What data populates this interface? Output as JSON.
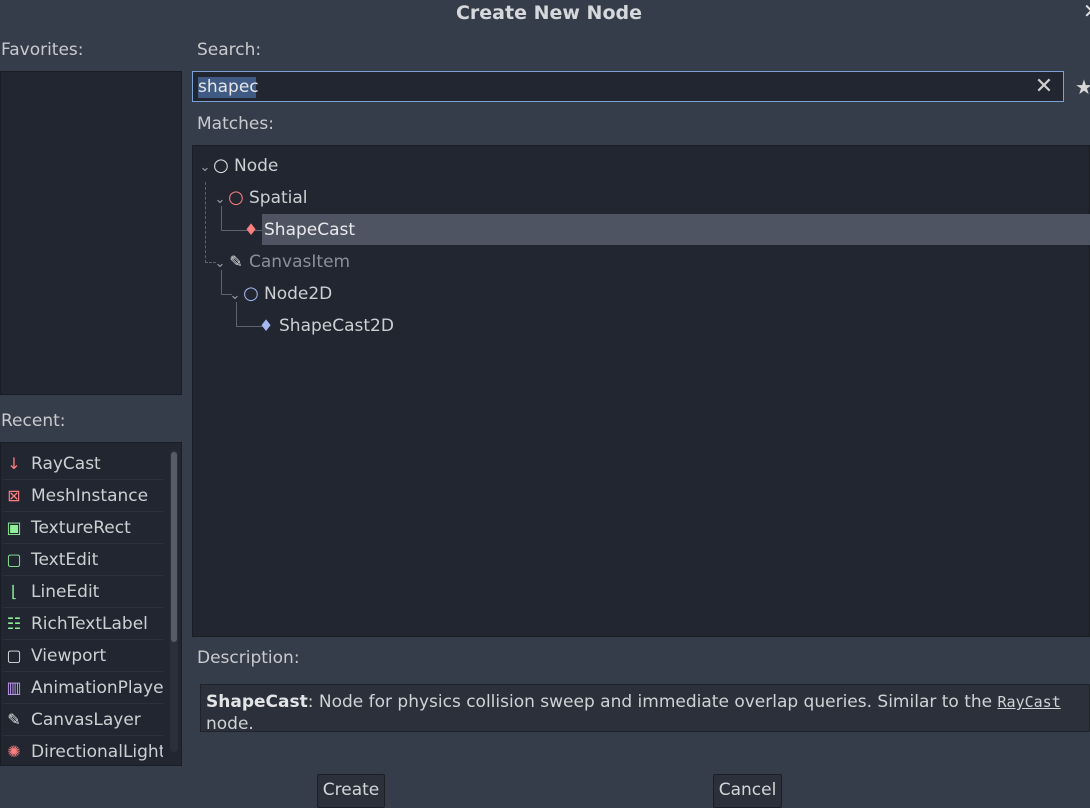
{
  "dialog": {
    "title": "Create New Node",
    "close_glyph": "✕"
  },
  "favorites": {
    "label": "Favorites:"
  },
  "search": {
    "label": "Search:",
    "value": "shapec",
    "clear_glyph": "✕",
    "favorite_glyph": "★"
  },
  "matches": {
    "label": "Matches:",
    "items": [
      {
        "label": "Node",
        "icon": "node-circle-icon",
        "color": "#e0e0e0"
      },
      {
        "label": "Spatial",
        "icon": "spatial-circle-icon",
        "color": "#fc7f7f"
      },
      {
        "label": "ShapeCast",
        "icon": "shapecast-icon",
        "color": "#fc7f7f"
      },
      {
        "label": "CanvasItem",
        "icon": "brush-icon",
        "color": "#e0e0e0"
      },
      {
        "label": "Node2D",
        "icon": "node2d-circle-icon",
        "color": "#a5b7f3"
      },
      {
        "label": "ShapeCast2D",
        "icon": "shapecast2d-icon",
        "color": "#a5b7f3"
      }
    ]
  },
  "recent": {
    "label": "Recent:",
    "items": [
      {
        "label": "RayCast",
        "icon": "raycast-arrow-icon",
        "color": "#fc7f7f",
        "glyph": "↓"
      },
      {
        "label": "MeshInstance",
        "icon": "mesh-instance-icon",
        "color": "#fc7f7f",
        "glyph": "⊠"
      },
      {
        "label": "TextureRect",
        "icon": "texture-rect-icon",
        "color": "#8eef97",
        "glyph": "▣"
      },
      {
        "label": "TextEdit",
        "icon": "text-edit-icon",
        "color": "#8eef97",
        "glyph": "▢"
      },
      {
        "label": "LineEdit",
        "icon": "line-edit-icon",
        "color": "#8eef97",
        "glyph": "⌊"
      },
      {
        "label": "RichTextLabel",
        "icon": "rich-text-label-icon",
        "color": "#8eef97",
        "glyph": "☷"
      },
      {
        "label": "Viewport",
        "icon": "viewport-icon",
        "color": "#e0e0e0",
        "glyph": "▢"
      },
      {
        "label": "AnimationPlaye",
        "icon": "animation-player-icon",
        "color": "#c49cf6",
        "glyph": "▥"
      },
      {
        "label": "CanvasLayer",
        "icon": "canvas-layer-icon",
        "color": "#e0e0e0",
        "glyph": "✎"
      },
      {
        "label": "DirectionalLight",
        "icon": "directional-light-icon",
        "color": "#fc7f7f",
        "glyph": "✺"
      }
    ]
  },
  "description": {
    "label": "Description:",
    "name": "ShapeCast",
    "text": ": Node for physics collision sweep and immediate overlap queries. Similar to the ",
    "link": "RayCast",
    "suffix": " node."
  },
  "buttons": {
    "create": "Create",
    "cancel": "Cancel"
  }
}
